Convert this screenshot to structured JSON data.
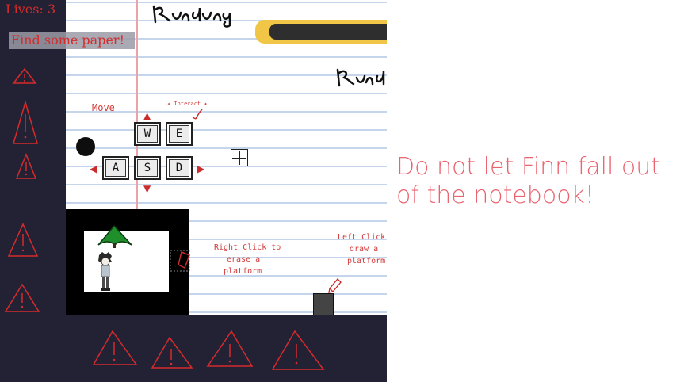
{
  "hud": {
    "lives_text": "Lives: 3",
    "objective_text": "Find some paper!"
  },
  "tutorial": {
    "move_label": "Move",
    "interact_label": "✦ Interact ✦",
    "keys": {
      "w": "W",
      "e": "E",
      "a": "A",
      "s": "S",
      "d": "D"
    },
    "right_click": [
      "Right Click to",
      "erase a",
      "platform"
    ],
    "left_click": [
      "Left Click",
      "draw a",
      "platform"
    ]
  },
  "hint": "Do not let Finn fall out of the notebook!",
  "colors": {
    "wall": "#232235",
    "hud_red": "#d62b2b",
    "hint_pink": "#ea6470",
    "notebook_line": "#c5d6ec",
    "margin_line": "#e9a3a9",
    "pencil_yellow": "#f1c545"
  },
  "icons": {
    "warning": "warning-triangle-icon",
    "tree": "tree-icon",
    "player": "player-character-icon",
    "eraser": "eraser-icon",
    "pencil": "pencil-icon",
    "crosshair": "crosshair-icon"
  }
}
